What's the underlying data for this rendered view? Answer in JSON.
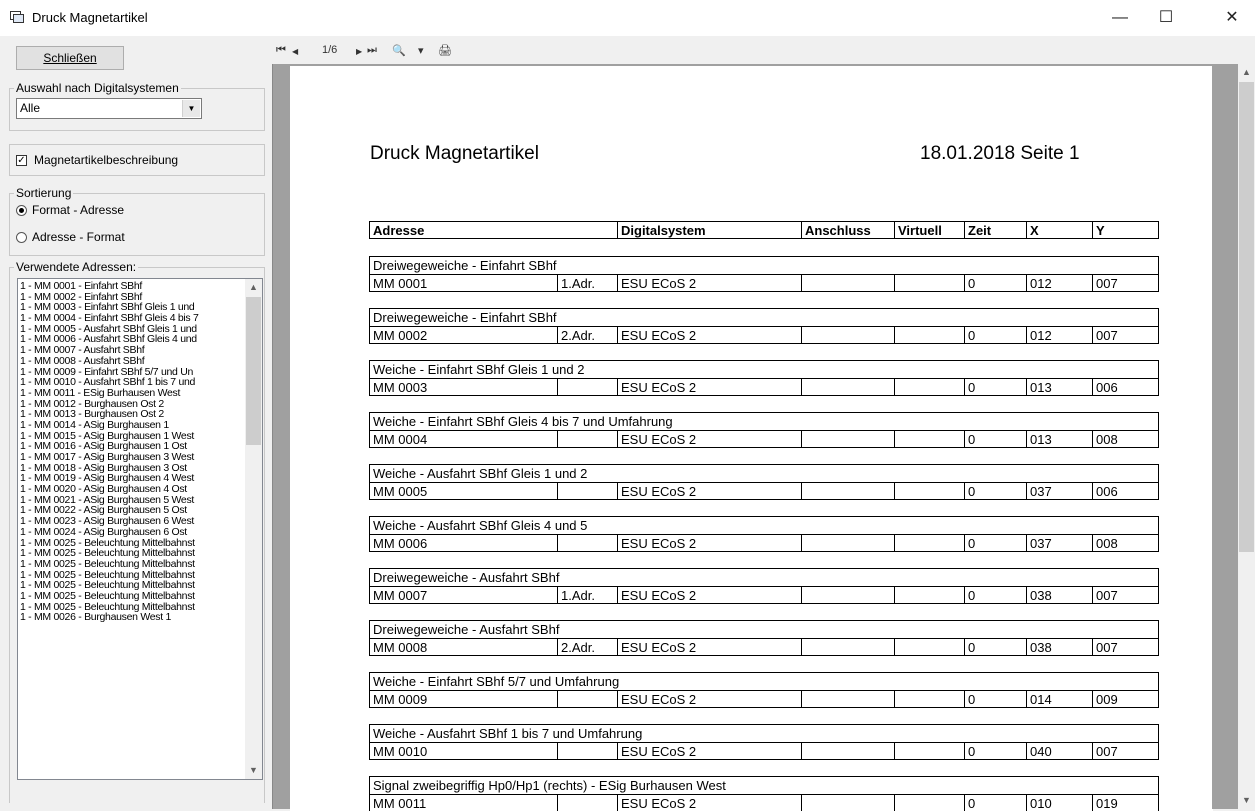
{
  "window": {
    "title": "Druck Magnetartikel",
    "minimize": "—",
    "maximize": "☐",
    "close": "✕"
  },
  "left": {
    "close_button": "Schließen",
    "digital_group": {
      "label": "Auswahl nach Digitalsystemen",
      "selected": "Alle"
    },
    "desc_checkbox": {
      "label": "Magnetartikelbeschreibung",
      "checked": true
    },
    "sort_group": {
      "label": "Sortierung",
      "options": [
        "Format - Adresse",
        "Adresse - Format"
      ],
      "selected": 0
    },
    "used_group": {
      "label": "Verwendete Adressen:",
      "items": [
        "1 - MM 0001 - Einfahrt SBhf",
        "1 - MM 0002 - Einfahrt SBhf",
        "1 - MM 0003 - Einfahrt SBhf Gleis 1 und",
        "1 - MM 0004 - Einfahrt SBhf Gleis 4 bis 7",
        "1 - MM 0005 - Ausfahrt SBhf Gleis 1 und",
        "1 - MM 0006 - Ausfahrt SBhf Gleis 4 und",
        "1 - MM 0007 - Ausfahrt SBhf",
        "1 - MM 0008 - Ausfahrt SBhf",
        "1 - MM 0009 - Einfahrt SBhf 5/7 und Un",
        "1 - MM 0010 - Ausfahrt SBhf 1 bis 7 und",
        "1 - MM 0011 - ESig Burhausen West",
        "1 - MM 0012 - Burghausen Ost 2",
        "1 - MM 0013 - Burghausen Ost 2",
        "1 - MM 0014 - ASig Burghausen 1",
        "1 - MM 0015 - ASig Burghausen 1 West",
        "1 - MM 0016 - ASig Burghausen 1 Ost",
        "1 - MM 0017 - ASig Burghausen 3 West",
        "1 - MM 0018 - ASig Burghausen 3 Ost",
        "1 - MM 0019 - ASig Burghausen 4 West",
        "1 - MM 0020 - ASig Burghausen 4 Ost",
        "1 - MM 0021 - ASig Burghausen 5 West",
        "1 - MM 0022 - ASig Burghausen 5 Ost",
        "1 - MM 0023 - ASig Burghausen 6 West",
        "1 - MM 0024 - ASig Burghausen 6 Ost",
        "1 - MM 0025 - Beleuchtung Mittelbahnst",
        "1 - MM 0025 - Beleuchtung Mittelbahnst",
        "1 - MM 0025 - Beleuchtung Mittelbahnst",
        "1 - MM 0025 - Beleuchtung Mittelbahnst",
        "1 - MM 0025 - Beleuchtung Mittelbahnst",
        "1 - MM 0025 - Beleuchtung Mittelbahnst",
        "1 - MM 0025 - Beleuchtung Mittelbahnst",
        "1 - MM 0026 - Burghausen West 1"
      ]
    }
  },
  "toolbar": {
    "first": "⏮",
    "prev": "◀",
    "page_indicator": "1/6",
    "next": "▶",
    "last": "⏭",
    "zoom": "🔍",
    "zoom_dropdown": "▾",
    "print": "🖨"
  },
  "report": {
    "title": "Druck Magnetartikel",
    "date_page": "18.01.2018 Seite 1",
    "headers": [
      "Adresse",
      "Digitalsystem",
      "Anschluss",
      "Virtuell",
      "Zeit",
      "X",
      "Y"
    ],
    "entries": [
      {
        "description": "Dreiwegeweiche - Einfahrt SBhf",
        "address": "MM 0001",
        "port": "1.Adr.",
        "system": "ESU ECoS 2",
        "connection": "",
        "virtual": "",
        "time": "0",
        "x": "012",
        "y": "007"
      },
      {
        "description": "Dreiwegeweiche - Einfahrt SBhf",
        "address": "MM 0002",
        "port": "2.Adr.",
        "system": "ESU ECoS 2",
        "connection": "",
        "virtual": "",
        "time": "0",
        "x": "012",
        "y": "007"
      },
      {
        "description": "Weiche - Einfahrt SBhf Gleis 1 und 2",
        "address": "MM 0003",
        "port": "",
        "system": "ESU ECoS 2",
        "connection": "",
        "virtual": "",
        "time": "0",
        "x": "013",
        "y": "006"
      },
      {
        "description": "Weiche - Einfahrt SBhf Gleis 4 bis 7 und Umfahrung",
        "address": "MM 0004",
        "port": "",
        "system": "ESU ECoS 2",
        "connection": "",
        "virtual": "",
        "time": "0",
        "x": "013",
        "y": "008"
      },
      {
        "description": "Weiche - Ausfahrt SBhf Gleis 1 und 2",
        "address": "MM 0005",
        "port": "",
        "system": "ESU ECoS 2",
        "connection": "",
        "virtual": "",
        "time": "0",
        "x": "037",
        "y": "006"
      },
      {
        "description": "Weiche - Ausfahrt SBhf Gleis 4 und 5",
        "address": "MM 0006",
        "port": "",
        "system": "ESU ECoS 2",
        "connection": "",
        "virtual": "",
        "time": "0",
        "x": "037",
        "y": "008"
      },
      {
        "description": "Dreiwegeweiche - Ausfahrt SBhf",
        "address": "MM 0007",
        "port": "1.Adr.",
        "system": "ESU ECoS 2",
        "connection": "",
        "virtual": "",
        "time": "0",
        "x": "038",
        "y": "007"
      },
      {
        "description": "Dreiwegeweiche - Ausfahrt SBhf",
        "address": "MM 0008",
        "port": "2.Adr.",
        "system": "ESU ECoS 2",
        "connection": "",
        "virtual": "",
        "time": "0",
        "x": "038",
        "y": "007"
      },
      {
        "description": "Weiche - Einfahrt SBhf 5/7 und Umfahrung",
        "address": "MM 0009",
        "port": "",
        "system": "ESU ECoS 2",
        "connection": "",
        "virtual": "",
        "time": "0",
        "x": "014",
        "y": "009"
      },
      {
        "description": "Weiche - Ausfahrt SBhf 1 bis 7 und Umfahrung",
        "address": "MM 0010",
        "port": "",
        "system": "ESU ECoS 2",
        "connection": "",
        "virtual": "",
        "time": "0",
        "x": "040",
        "y": "007"
      },
      {
        "description": "Signal zweibegriffig Hp0/Hp1 (rechts) - ESig Burhausen West",
        "address": "MM 0011",
        "port": "",
        "system": "ESU ECoS 2",
        "connection": "",
        "virtual": "",
        "time": "0",
        "x": "010",
        "y": "019"
      }
    ]
  }
}
